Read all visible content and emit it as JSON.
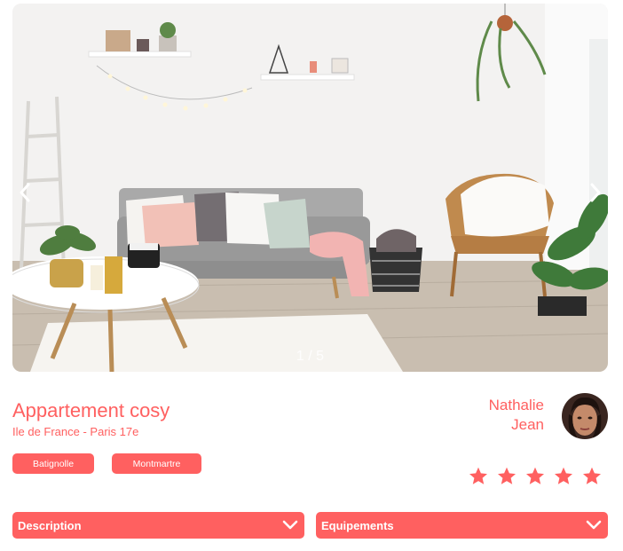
{
  "gallery": {
    "counter": "1 / 5",
    "prev_icon": "chevron-left-icon",
    "next_icon": "chevron-right-icon"
  },
  "listing": {
    "title": "Appartement cosy",
    "location": "Ile de France - Paris 17e",
    "tags": [
      "Batignolle",
      "Montmartre"
    ]
  },
  "host": {
    "first_name": "Nathalie",
    "last_name": "Jean"
  },
  "rating": {
    "value": 5,
    "max": 5,
    "active_color": "#ff6060",
    "inactive_color": "#e3e3e3"
  },
  "collapses": [
    {
      "label": "Description",
      "icon": "chevron-down-icon"
    },
    {
      "label": "Equipements",
      "icon": "chevron-down-icon"
    }
  ],
  "colors": {
    "accent": "#ff6060"
  }
}
